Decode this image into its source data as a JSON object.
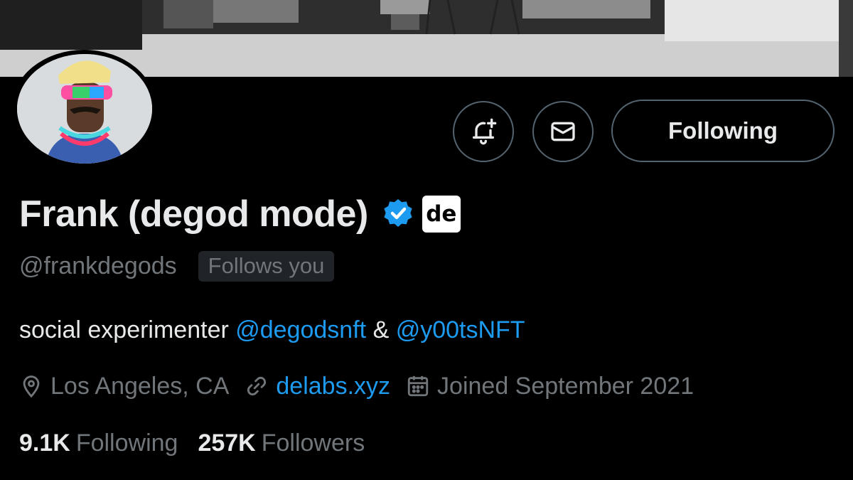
{
  "profile": {
    "display_name": "Frank (degod mode)",
    "handle": "@frankdegods",
    "follows_you": "Follows you",
    "affiliate_badge": "de",
    "bio_prefix": "social experimenter ",
    "bio_mention_1": "@degodsnft",
    "bio_separator": " & ",
    "bio_mention_2": "@y00tsNFT",
    "location": "Los Angeles, CA",
    "website": "delabs.xyz",
    "joined": "Joined September 2021"
  },
  "actions": {
    "follow_state_label": "Following"
  },
  "stats": {
    "following_count": "9.1K",
    "following_label": "Following",
    "followers_count": "257K",
    "followers_label": "Followers"
  },
  "icons": [
    "notification-bell-plus-icon",
    "message-envelope-icon",
    "verified-badge-icon",
    "location-pin-icon",
    "link-icon",
    "calendar-icon"
  ],
  "colors": {
    "accent": "#1d9bf0",
    "text": "#e7e9ea",
    "muted": "#71767b",
    "background": "#000000"
  }
}
